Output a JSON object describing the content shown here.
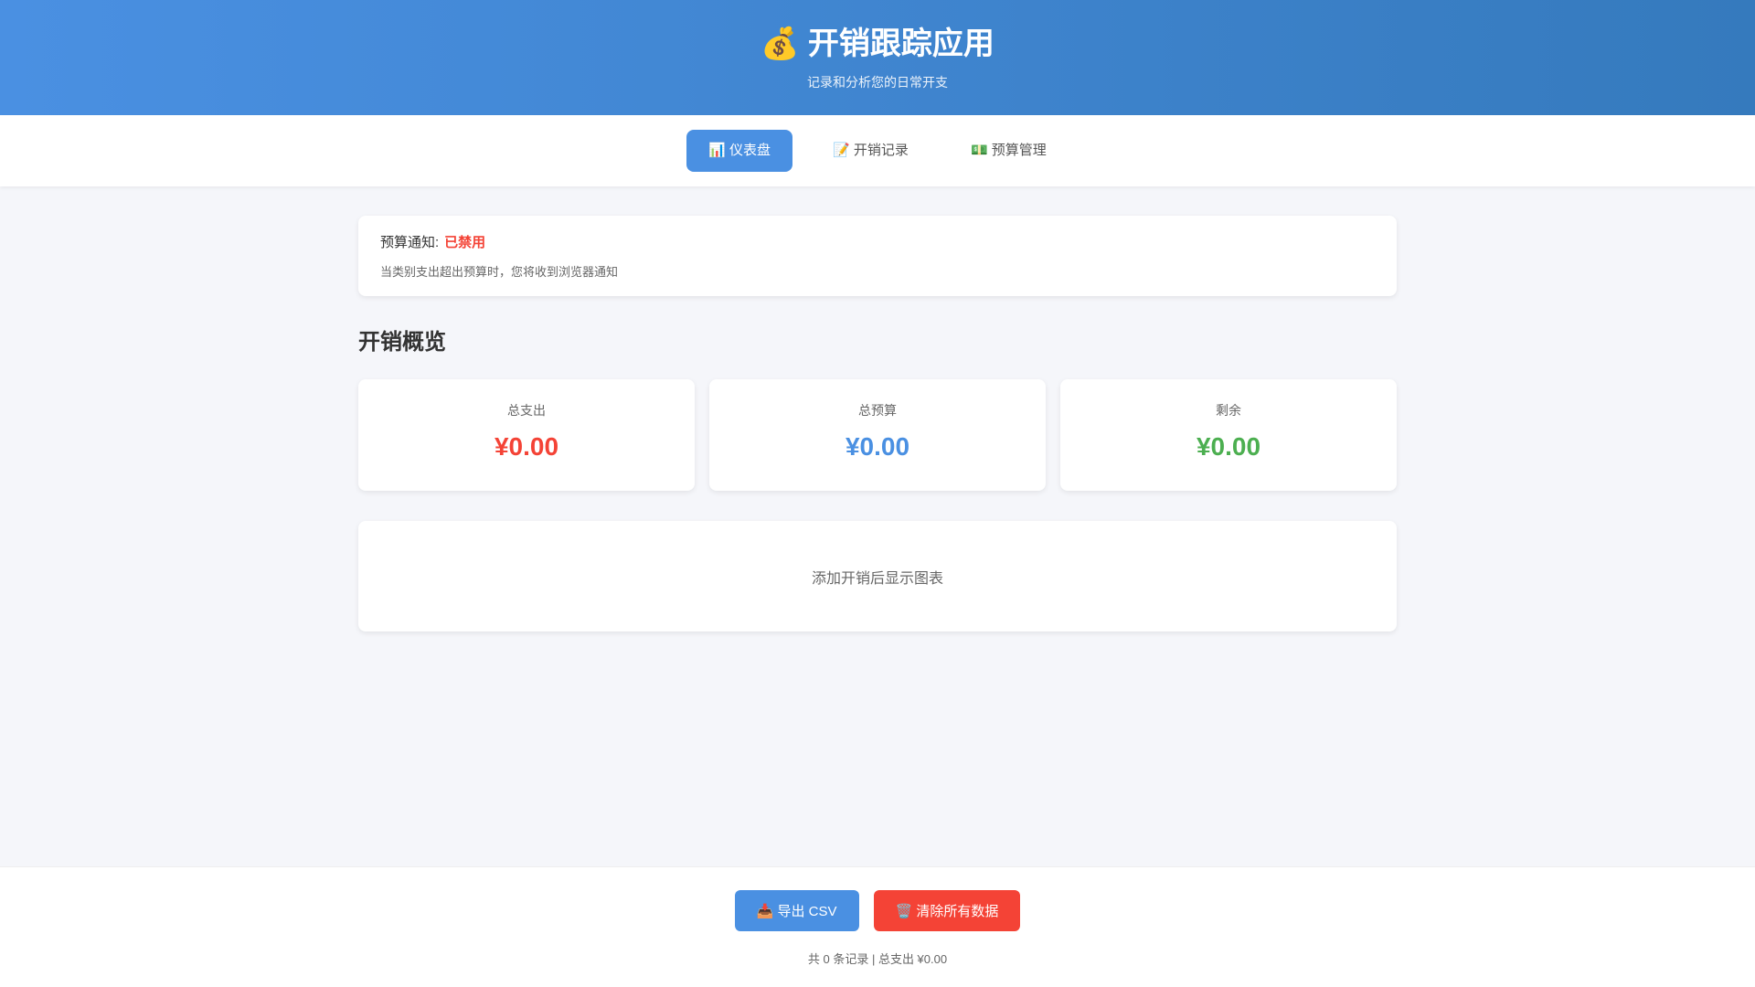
{
  "header": {
    "icon": "💰",
    "title": "开销跟踪应用",
    "subtitle": "记录和分析您的日常开支"
  },
  "nav": {
    "tabs": [
      {
        "icon": "📊",
        "label": "仪表盘",
        "active": true
      },
      {
        "icon": "📝",
        "label": "开销记录"
      },
      {
        "icon": "💵",
        "label": "预算管理"
      }
    ]
  },
  "notice": {
    "label": "预算通知:",
    "status": "已禁用",
    "description": "当类别支出超出预算时，您将收到浏览器通知"
  },
  "overview": {
    "title": "开销概览",
    "stats": [
      {
        "label": "总支出",
        "value": "¥0.00",
        "color": "#f44336"
      },
      {
        "label": "总预算",
        "value": "¥0.00",
        "color": "#4a90e2"
      },
      {
        "label": "剩余",
        "value": "¥0.00",
        "color": "#4caf50"
      }
    ]
  },
  "chart": {
    "placeholder": "添加开销后显示图表"
  },
  "footer": {
    "export_icon": "📥",
    "export_label": "导出 CSV",
    "clear_icon": "🗑️",
    "clear_label": "清除所有数据",
    "summary": "共 0 条记录 | 总支出 ¥0.00"
  }
}
